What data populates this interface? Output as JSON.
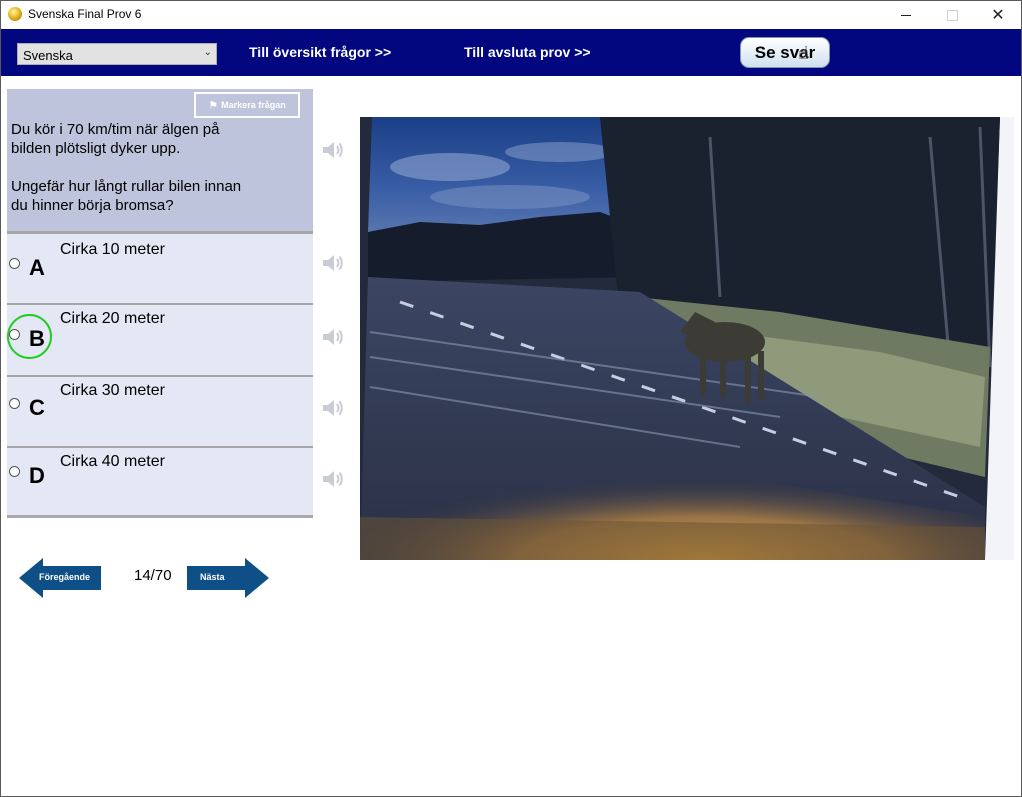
{
  "window": {
    "title": "Svenska Final Prov 6",
    "icon": "coin-icon"
  },
  "toolbar": {
    "language_selected": "Svenska",
    "overview_link": "Till översikt frågor >>",
    "finish_link": "Till avsluta prov  >>",
    "see_answer_button": "Se svar",
    "background_color": "#02067f"
  },
  "question": {
    "mark_button": "Markera frågan",
    "lines": [
      "Du kör i 70 km/tim när älgen på",
      "bilden plötsligt dyker upp.",
      "Ungefär hur långt rullar bilen innan",
      "du hinner börja bromsa?"
    ],
    "panel_color": "#bec4dc"
  },
  "answers": [
    {
      "letter": "A",
      "text": "Cirka 10 meter",
      "highlighted": false
    },
    {
      "letter": "B",
      "text": "Cirka 20 meter",
      "highlighted": true
    },
    {
      "letter": "C",
      "text": "Cirka 30 meter",
      "highlighted": false
    },
    {
      "letter": "D",
      "text": "Cirka 40 meter",
      "highlighted": false
    }
  ],
  "navigation": {
    "previous_label": "Föregående",
    "next_label": "Nästa",
    "counter": "14/70",
    "arrow_color": "#0d4f86"
  },
  "image": {
    "subject": "moose-crossing-road-photo"
  }
}
